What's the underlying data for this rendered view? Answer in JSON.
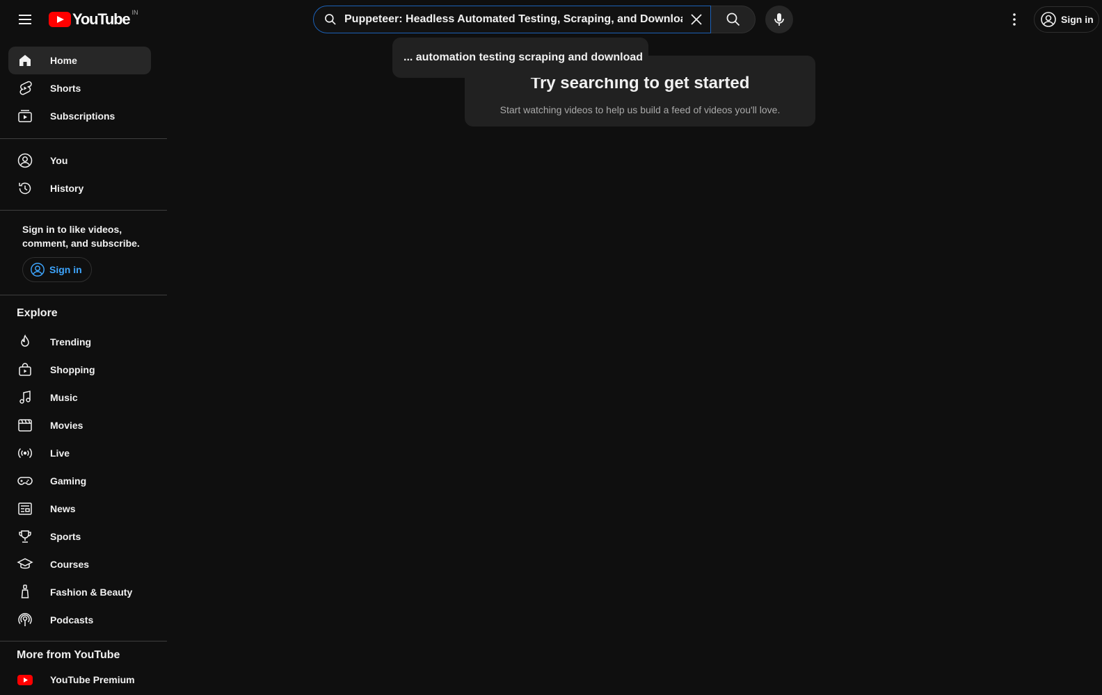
{
  "header": {
    "logo_text": "YouTube",
    "logo_country": "IN",
    "search_value": "Puppeteer: Headless Automated Testing, Scraping, and Downloading",
    "sign_in_label": "Sign in"
  },
  "search_suggestion": "... automation testing scraping and download",
  "empty_state": {
    "title": "Try searching to get started",
    "subtitle": "Start watching videos to help us build a feed of videos you'll love."
  },
  "sidebar": {
    "main_items": [
      {
        "label": "Home",
        "icon": "home-icon"
      },
      {
        "label": "Shorts",
        "icon": "shorts-icon"
      },
      {
        "label": "Subscriptions",
        "icon": "subscriptions-icon"
      }
    ],
    "you_items": [
      {
        "label": "You",
        "icon": "you-icon"
      },
      {
        "label": "History",
        "icon": "history-icon"
      }
    ],
    "signin_prompt": "Sign in to like videos, comment, and subscribe.",
    "signin_button": "Sign in",
    "explore_title": "Explore",
    "explore_items": [
      {
        "label": "Trending",
        "icon": "trending-icon"
      },
      {
        "label": "Shopping",
        "icon": "shopping-icon"
      },
      {
        "label": "Music",
        "icon": "music-icon"
      },
      {
        "label": "Movies",
        "icon": "movies-icon"
      },
      {
        "label": "Live",
        "icon": "live-icon"
      },
      {
        "label": "Gaming",
        "icon": "gaming-icon"
      },
      {
        "label": "News",
        "icon": "news-icon"
      },
      {
        "label": "Sports",
        "icon": "sports-icon"
      },
      {
        "label": "Courses",
        "icon": "courses-icon"
      },
      {
        "label": "Fashion & Beauty",
        "icon": "fashion-icon"
      },
      {
        "label": "Podcasts",
        "icon": "podcasts-icon"
      }
    ],
    "more_title": "More from YouTube",
    "more_items": [
      {
        "label": "YouTube Premium",
        "icon": "youtube-premium-icon"
      }
    ]
  },
  "colors": {
    "background": "#0f0f0f",
    "brand_red": "#ff0000",
    "link_blue": "#3ea6ff",
    "focus_blue": "#1c62b9"
  }
}
